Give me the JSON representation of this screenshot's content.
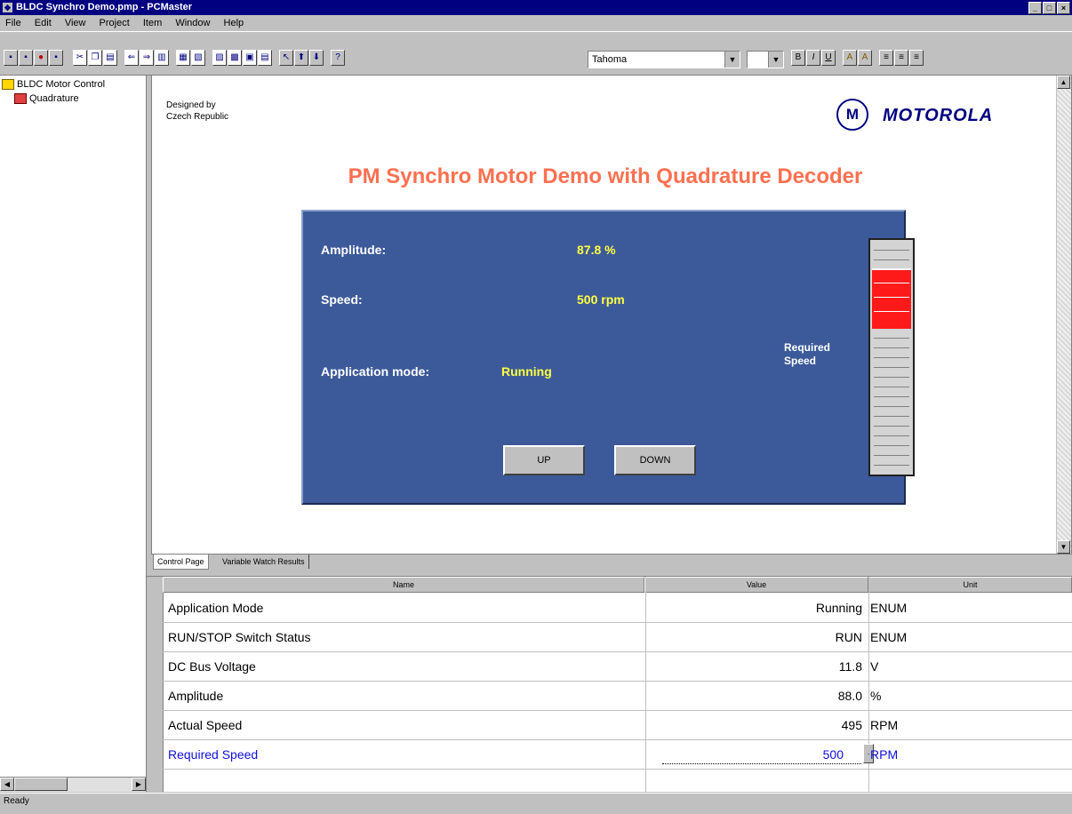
{
  "window": {
    "title": "BLDC Synchro Demo.pmp - PCMaster"
  },
  "menu": [
    "File",
    "Edit",
    "View",
    "Project",
    "Item",
    "Window",
    "Help"
  ],
  "toolbar": {
    "font_combo": "Tahoma"
  },
  "tree": {
    "root": "BLDC Motor Control",
    "child": "Quadrature"
  },
  "main": {
    "designed_by": [
      "Designed by",
      "Czech Republic"
    ],
    "logo_text": "MOTOROLA",
    "title": "PM Synchro Motor Demo with Quadrature Decoder",
    "panel": {
      "amplitude_label": "Amplitude:",
      "amplitude_value": "87.8 %",
      "speed_label": "Speed:",
      "speed_value": "500 rpm",
      "mode_label": "Application mode:",
      "mode_value": "Running",
      "up_button": "UP",
      "down_button": "DOWN",
      "slider_label": [
        "Required",
        "Speed"
      ],
      "slider_level": 0.57
    }
  },
  "tabs": [
    "Control Page",
    "Variable Watch Results"
  ],
  "grid": {
    "headers": [
      "Name",
      "Value",
      "Unit"
    ],
    "rows": [
      {
        "name": "Application Mode",
        "value": "Running",
        "unit": "ENUM"
      },
      {
        "name": "RUN/STOP Switch Status",
        "value": "RUN",
        "unit": "ENUM"
      },
      {
        "name": "DC Bus Voltage",
        "value": "11.8",
        "unit": "V"
      },
      {
        "name": "Amplitude",
        "value": "88.0",
        "unit": "%"
      },
      {
        "name": "Actual Speed",
        "value": "495",
        "unit": "RPM"
      },
      {
        "name": "Required Speed",
        "value": "500",
        "unit": "RPM"
      }
    ]
  },
  "status": {
    "text": "Ready"
  },
  "colors": {
    "title": "#ff7050",
    "panel": "#3c5a9a",
    "value_yellow": "#ffff40",
    "slider_red": "#ff1a1a",
    "titlebar": "#000080"
  }
}
